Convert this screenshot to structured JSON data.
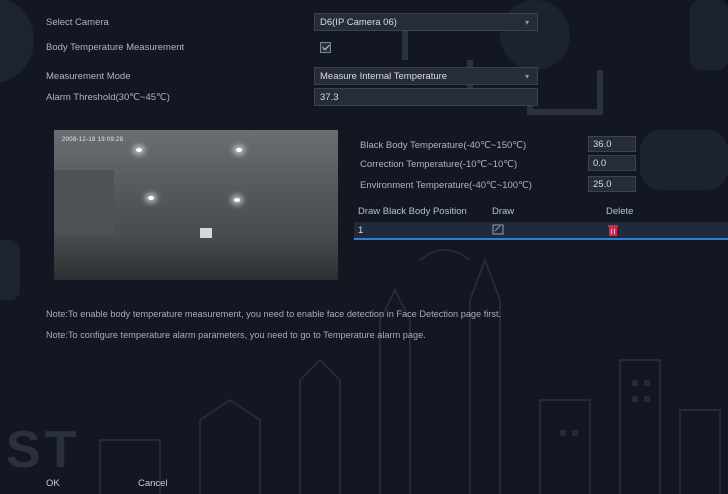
{
  "form": {
    "camera_label": "Select Camera",
    "camera_value": "D6(IP Camera 06)",
    "body_temp_label": "Body Temperature Measurement",
    "body_temp_checked": true,
    "mode_label": "Measurement Mode",
    "mode_value": "Measure Internal Temperature",
    "alarm_label": "Alarm Threshold(30℃~45℃)",
    "alarm_value": "37.3"
  },
  "video": {
    "osd_timestamp": "2008-12-18 19:09:28"
  },
  "calibration": {
    "black_body_label": "Black Body Temperature(-40℃~150℃)",
    "black_body_value": "36.0",
    "correction_label": "Correction Temperature(-10℃~10℃)",
    "correction_value": "0.0",
    "environment_label": "Environment Temperature(-40℃~100℃)",
    "environment_value": "25.0"
  },
  "position_table": {
    "headers": [
      "Draw Black Body Position",
      "Draw",
      "Delete"
    ],
    "rows": [
      {
        "index": "1"
      }
    ]
  },
  "notes": [
    "Note:To enable body temperature measurement, you need to enable face detection in Face Detection page first.",
    "Note:To configure temperature alarm parameters, you need to go to Temperature alarm page."
  ],
  "buttons": {
    "ok": "OK",
    "cancel": "Cancel"
  },
  "colors": {
    "background": "#121722",
    "accent": "#2f7fd6",
    "delete": "#d6284a",
    "field": "#262c38"
  },
  "icons": [
    "chevron-down-icon",
    "checkbox-checked-icon",
    "draw-icon",
    "delete-icon"
  ]
}
